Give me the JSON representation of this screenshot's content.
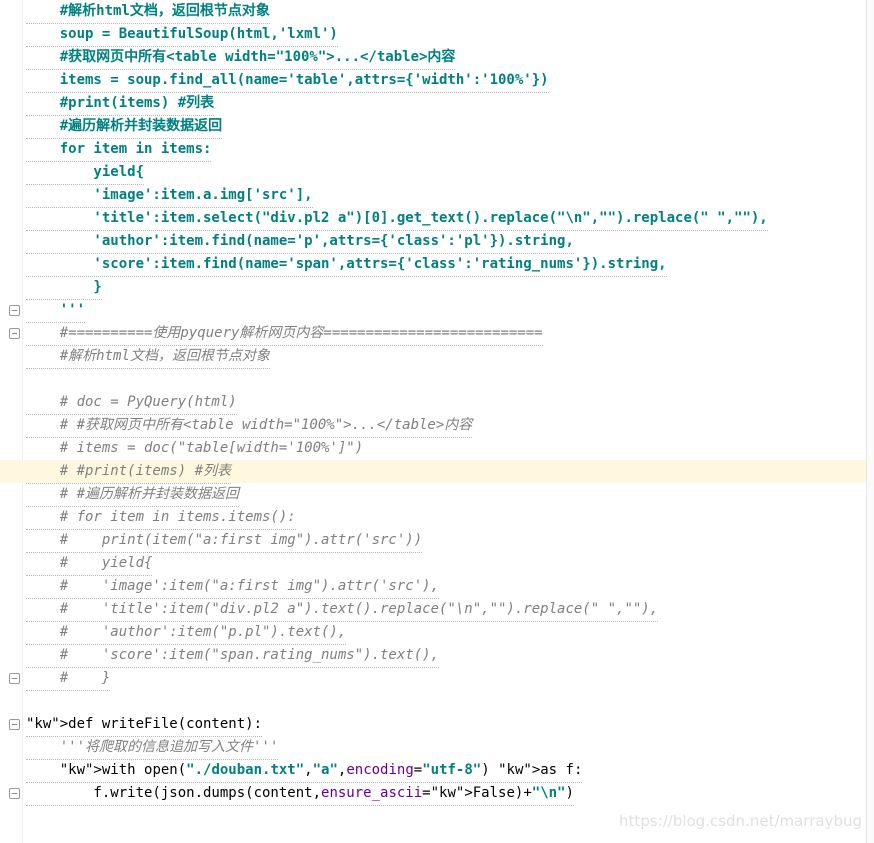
{
  "editor": {
    "lines": [
      {
        "text": "    #解析html文档，返回根节点对象",
        "kind": "doc"
      },
      {
        "text": "    soup = BeautifulSoup(html,'lxml')",
        "kind": "doc"
      },
      {
        "text": "    #获取网页中所有<table width=\"100%\">...</table>内容",
        "kind": "doc"
      },
      {
        "text": "    items = soup.find_all(name='table',attrs={'width':'100%'})",
        "kind": "doc"
      },
      {
        "text": "    #print(items) #列表",
        "kind": "doc"
      },
      {
        "text": "    #遍历解析并封装数据返回",
        "kind": "doc"
      },
      {
        "text": "    for item in items:",
        "kind": "doc"
      },
      {
        "text": "        yield{",
        "kind": "doc"
      },
      {
        "text": "        'image':item.a.img['src'],",
        "kind": "doc"
      },
      {
        "text": "        'title':item.select(\"div.pl2 a\")[0].get_text().replace(\"\\n\",\"\").replace(\" \",\"\"),",
        "kind": "doc"
      },
      {
        "text": "        'author':item.find(name='p',attrs={'class':'pl'}).string,",
        "kind": "doc"
      },
      {
        "text": "        'score':item.find(name='span',attrs={'class':'rating_nums'}).string,",
        "kind": "doc"
      },
      {
        "text": "        }",
        "kind": "doc"
      },
      {
        "text": "    '''",
        "kind": "doc"
      },
      {
        "text": "    #==========使用pyquery解析网页内容==========================",
        "kind": "cm"
      },
      {
        "text": "    #解析html文档，返回根节点对象",
        "kind": "cm"
      },
      {
        "text": "",
        "kind": "plain"
      },
      {
        "text": "    # doc = PyQuery(html)",
        "kind": "cm"
      },
      {
        "text": "    # #获取网页中所有<table width=\"100%\">...</table>内容",
        "kind": "cm"
      },
      {
        "text": "    # items = doc(\"table[width='100%']\")",
        "kind": "cm"
      },
      {
        "text": "    # #print(items) #列表",
        "kind": "cm"
      },
      {
        "text": "    # #遍历解析并封装数据返回",
        "kind": "cm"
      },
      {
        "text": "    # for item in items.items():",
        "kind": "cm"
      },
      {
        "text": "    #    print(item(\"a:first img\").attr('src'))",
        "kind": "cm"
      },
      {
        "text": "    #    yield{",
        "kind": "cm"
      },
      {
        "text": "    #    'image':item(\"a:first img\").attr('src'),",
        "kind": "cm"
      },
      {
        "text": "    #    'title':item(\"div.pl2 a\").text().replace(\"\\n\",\"\").replace(\" \",\"\"),",
        "kind": "cm"
      },
      {
        "text": "    #    'author':item(\"p.pl\").text(),",
        "kind": "cm"
      },
      {
        "text": "    #    'score':item(\"span.rating_nums\").text(),",
        "kind": "cm"
      },
      {
        "text": "    #    }",
        "kind": "cm"
      },
      {
        "text": "",
        "kind": "plain"
      },
      {
        "text": "def writeFile(content):",
        "kind": "plain"
      },
      {
        "text": "    '''将爬取的信息追加写入文件'''",
        "kind": "cm"
      },
      {
        "text": "    with open(\"./douban.txt\",\"a\",encoding=\"utf-8\") as f:",
        "kind": "plain"
      },
      {
        "text": "        f.write(json.dumps(content,ensure_ascii=False)+\"\\n\")",
        "kind": "plain"
      }
    ],
    "highlighted_line": 20,
    "fold_markers": [
      13,
      14,
      29,
      31,
      34
    ]
  },
  "watermark": "https://blog.csdn.net/marraybug",
  "colors": {
    "docstring": "#008080",
    "keyword": "#000080",
    "comment": "#808080",
    "highlight_bg": "#fff8df"
  }
}
